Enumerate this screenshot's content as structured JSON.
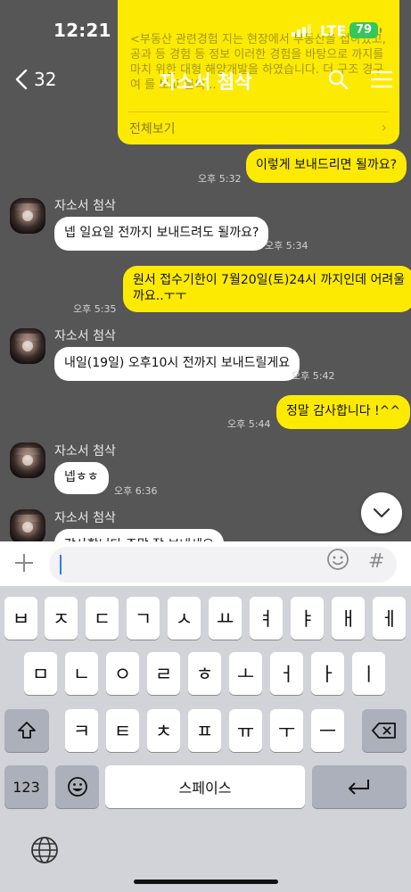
{
  "status_bar": {
    "time": "12:21",
    "network": "LTE",
    "battery": "79"
  },
  "notice": {
    "text": "<부동산 관련경험 지는 현장에서 부동산을 접하였고, 공과 등 경험 등 정보 이러한 경험을 바탕으로 까지를 마치 위한 대형 해양개발을 하였습니다. 더 구조 경구 여 를 보고 분의...",
    "more_label": "전체보기"
  },
  "nav": {
    "back_count": "32",
    "title": "자소서 첨삭"
  },
  "messages": [
    {
      "side": "me",
      "text": "이렇게 보내드리면 될까요?",
      "time": "오후 5:32"
    },
    {
      "side": "them",
      "sender": "자소서 첨삭",
      "text": "넵 일요일 전까지 보내드려도 될까요?",
      "time": "오후 5:34"
    },
    {
      "side": "me",
      "line1": "원서 접수기한이 7월20일(토)24시 까지인데 어려울",
      "line2": "까요..ㅜㅜ",
      "time": "오후 5:35"
    },
    {
      "side": "them",
      "sender": "자소서 첨삭",
      "text": "내일(19일) 오후10시 전까지 보내드릴게요",
      "time": "오후 5:42"
    },
    {
      "side": "me",
      "text": "정말 감사합니다 !^^",
      "time": "오후 5:44"
    },
    {
      "side": "them",
      "sender": "자소서 첨삭",
      "text": "넵ㅎㅎ",
      "time": "오후 6:36"
    },
    {
      "side": "them",
      "sender": "자소서 첨삭",
      "text": "감사합니다 주말 잘 보내세요"
    }
  ],
  "keyboard": {
    "row1": [
      "ㅂ",
      "ㅈ",
      "ㄷ",
      "ㄱ",
      "ㅅ",
      "ㅛ",
      "ㅕ",
      "ㅑ",
      "ㅐ",
      "ㅔ"
    ],
    "row2": [
      "ㅁ",
      "ㄴ",
      "ㅇ",
      "ㄹ",
      "ㅎ",
      "ㅗ",
      "ㅓ",
      "ㅏ",
      "ㅣ"
    ],
    "row3": [
      "ㅋ",
      "ㅌ",
      "ㅊ",
      "ㅍ",
      "ㅠ",
      "ㅜ",
      "ㅡ"
    ],
    "numbers_label": "123",
    "space_label": "스페이스"
  },
  "colors": {
    "chat_bg": "#565656",
    "my_bubble": "#fdea02",
    "their_bubble": "#ffffff",
    "battery": "#34c759"
  }
}
